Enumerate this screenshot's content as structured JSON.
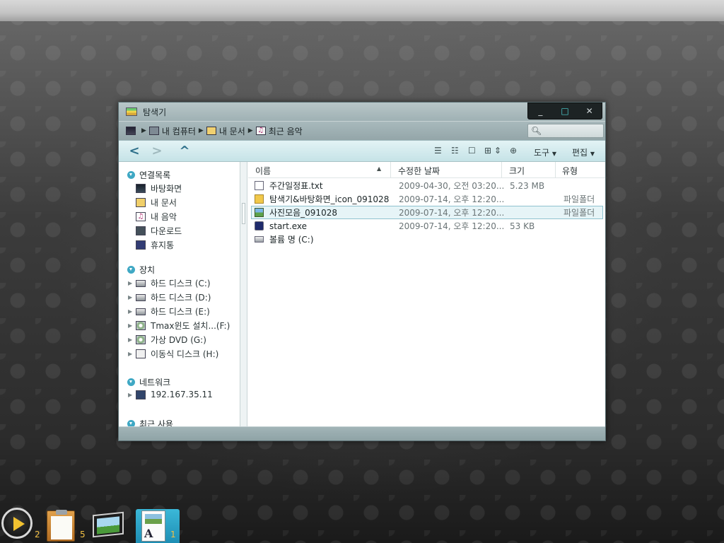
{
  "window": {
    "title": "탐색기",
    "controls": {
      "minimize": "_",
      "maximize": "□",
      "close": "✕"
    }
  },
  "address": {
    "crumbs": [
      {
        "label": "내 컴퓨터",
        "icon": "computer-icon"
      },
      {
        "label": "내 문서",
        "icon": "documents-folder-icon"
      },
      {
        "label": "최근 음악",
        "icon": "music-icon"
      }
    ],
    "search_placeholder": ""
  },
  "toolbar": {
    "back": "<",
    "forward": ">",
    "up": "^",
    "tools_label": "도구",
    "edit_label": "편집",
    "view_icons": [
      "list-view-icon",
      "details-view-icon",
      "single-view-icon",
      "grid-view-icon",
      "new-folder-icon"
    ]
  },
  "sidebar": {
    "sections": [
      {
        "title": "연결목록",
        "items": [
          {
            "label": "바탕화면",
            "icon": "desktop-icon"
          },
          {
            "label": "내 문서",
            "icon": "documents-icon"
          },
          {
            "label": "내 음악",
            "icon": "music-icon"
          },
          {
            "label": "다운로드",
            "icon": "download-icon"
          },
          {
            "label": "휴지통",
            "icon": "trash-icon"
          }
        ]
      },
      {
        "title": "장치",
        "items": [
          {
            "label": "하드 디스크 (C:)",
            "icon": "hard-disk-icon"
          },
          {
            "label": "하드 디스크 (D:)",
            "icon": "hard-disk-icon"
          },
          {
            "label": "하드 디스크 (E:)",
            "icon": "hard-disk-icon"
          },
          {
            "label": "Tmax윈도 설치...(F:)",
            "icon": "cd-drive-icon"
          },
          {
            "label": "가상 DVD (G:)",
            "icon": "cd-drive-icon"
          },
          {
            "label": "이동식 디스크 (H:)",
            "icon": "usb-drive-icon"
          }
        ]
      },
      {
        "title": "네트워크",
        "items": [
          {
            "label": "192.167.35.11",
            "icon": "network-icon"
          }
        ]
      },
      {
        "title": "최근 사용",
        "items": []
      }
    ]
  },
  "content": {
    "columns": {
      "name": "이름",
      "modified": "수정한 날짜",
      "size": "크기",
      "type": "유형"
    },
    "files": [
      {
        "name": "주간일정표.txt",
        "modified": "2009-04-30, 오전 03:20...",
        "size": "5.23 MB",
        "type": "",
        "icon": "text-file-icon"
      },
      {
        "name": "탐색기&바탕화면_icon_091028",
        "modified": "2009-07-14, 오후 12:20...",
        "size": "",
        "type": "파일폴더",
        "icon": "folder-icon"
      },
      {
        "name": "사진모음_091028",
        "modified": "2009-07-14, 오후 12:20...",
        "size": "",
        "type": "파일폴더",
        "icon": "photo-folder-icon",
        "selected": true
      },
      {
        "name": "start.exe",
        "modified": "2009-07-14, 오후 12:20...",
        "size": "53 KB",
        "type": "",
        "icon": "executable-icon"
      },
      {
        "name": "볼륨 명 (C:)",
        "modified": "",
        "size": "",
        "type": "",
        "icon": "volume-icon"
      }
    ]
  },
  "dock": [
    {
      "name": "media-player",
      "badge": "2"
    },
    {
      "name": "clipboard-notes",
      "badge": "5"
    },
    {
      "name": "photo-viewer",
      "badge": ""
    },
    {
      "name": "document-editor",
      "badge": "1",
      "active": true
    }
  ],
  "colors": {
    "accent": "#3fa8c4",
    "selection_bg": "#e6f4f7",
    "dock_badge": "#f3c044"
  }
}
